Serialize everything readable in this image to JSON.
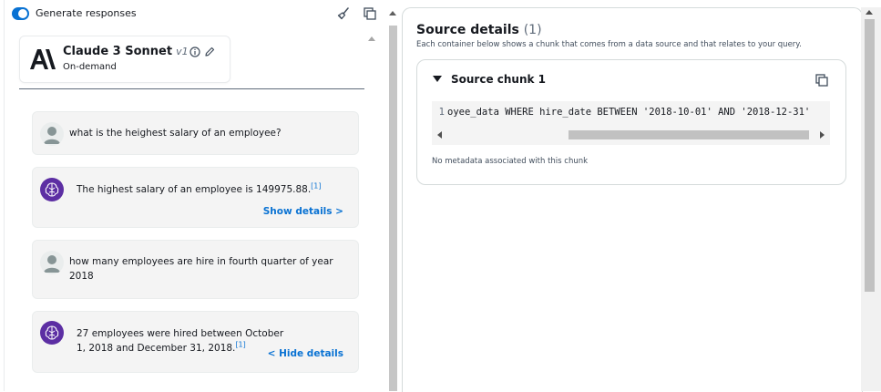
{
  "toolbar": {
    "generate_label": "Generate responses",
    "generate_enabled": true
  },
  "model": {
    "name": "Claude 3 Sonnet",
    "version": "v1",
    "subtitle": "On-demand"
  },
  "chat": {
    "messages": [
      {
        "role": "user",
        "text": "what is the heighest salary of an employee?"
      },
      {
        "role": "assistant",
        "text": "The highest salary of an employee is 149975.88.",
        "citation": "[1]",
        "details_label": "Show details >"
      },
      {
        "role": "user",
        "text": "how many employees are hire in fourth quarter of year 2018"
      },
      {
        "role": "assistant",
        "text": "27 employees were hired between October 1, 2018 and December 31, 2018.",
        "citation": "[1]",
        "details_label": "< Hide details"
      }
    ]
  },
  "source": {
    "title": "Source details",
    "count": "(1)",
    "description": "Each container below shows a chunk that comes from a data source and that relates to your query.",
    "chunk": {
      "title": "Source chunk 1",
      "line_number": "1",
      "code": "oyee_data WHERE hire_date BETWEEN '2018-10-01' AND '2018-12-31'",
      "metadata_note": "No metadata associated with this chunk"
    }
  },
  "colors": {
    "accent": "#0972d3",
    "assistant_avatar": "#5c2ea3",
    "message_bg": "#f4f4f4"
  }
}
